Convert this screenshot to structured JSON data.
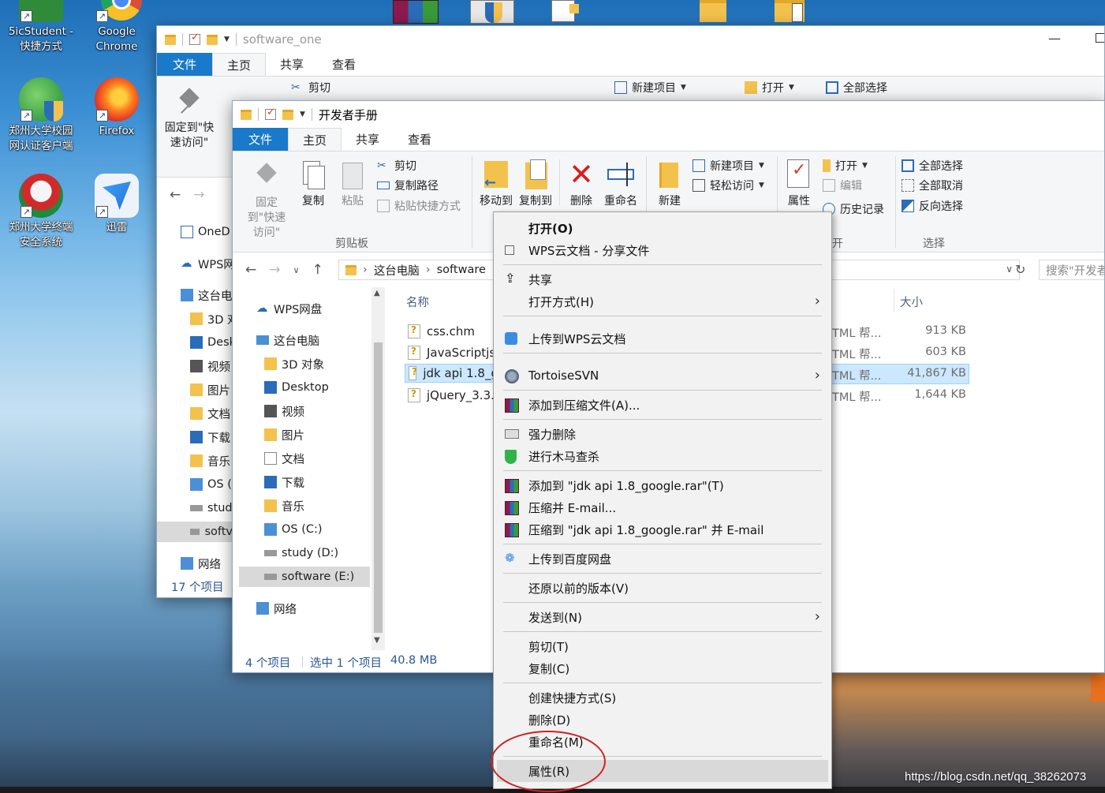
{
  "desktop": {
    "icons": [
      {
        "label1": "5icStudent -",
        "label2": "快捷方式",
        "color": "#2f8a3a"
      },
      {
        "label1": "Google",
        "label2": "Chrome",
        "color": "#dd4b39"
      },
      {
        "label1": "郑州大学校园",
        "label2": "网认证客户端",
        "color": "#1e8a3c"
      },
      {
        "label1": "Firefox",
        "label2": "",
        "color": "#ff7f1e"
      },
      {
        "label1": "郑州大学终端",
        "label2": "安全系统",
        "color": "#d12a2a"
      },
      {
        "label1": "迅雷",
        "label2": "",
        "color": "#2b6fdb"
      }
    ],
    "watermark": "https://blog.csdn.net/qq_38262073"
  },
  "back_window": {
    "title": "software_one",
    "tabs": [
      "文件",
      "主页",
      "共享",
      "查看"
    ],
    "ribbon": {
      "pin_label": "固定到\"快速访问\"",
      "cut": "剪切",
      "new_item": "新建项目",
      "open": "打开",
      "select_all": "全部选择"
    },
    "nav": [
      "OneD",
      "WPS网",
      "这台电",
      "3D 对",
      "Desk",
      "视频",
      "图片",
      "文档",
      "下载",
      "音乐",
      "OS (",
      "stud",
      "softv",
      "网络"
    ],
    "status": "17 个项目"
  },
  "front_window": {
    "title": "开发者手册",
    "tabs": [
      "文件",
      "主页",
      "共享",
      "查看"
    ],
    "ribbon": {
      "pin": "固定到\"快速访问\"",
      "copy": "复制",
      "paste": "粘贴",
      "cut": "剪切",
      "copy_path": "复制路径",
      "paste_shortcut": "粘贴快捷方式",
      "clipboard_group": "剪贴板",
      "move_to": "移动到",
      "copy_to": "复制到",
      "delete": "删除",
      "rename": "重命名",
      "new": "新建",
      "new_item": "新建项目",
      "easy_access": "轻松访问",
      "properties": "属性",
      "open": "打开",
      "edit": "编辑",
      "history": "历史记录",
      "open_group": "开",
      "select_all": "全部选择",
      "select_none": "全部取消",
      "invert": "反向选择",
      "select_group": "选择"
    },
    "address": {
      "seg1": "这台电脑",
      "seg2": "software"
    },
    "search_placeholder": "搜索\"开发者",
    "nav": [
      {
        "label": "WPS网盘",
        "icon": "cloud-icon"
      },
      {
        "label": "这台电脑",
        "icon": "pc-icon"
      },
      {
        "label": "3D 对象",
        "icon": "folder-icon"
      },
      {
        "label": "Desktop",
        "icon": "folder-icon"
      },
      {
        "label": "视频",
        "icon": "folder-icon"
      },
      {
        "label": "图片",
        "icon": "folder-icon"
      },
      {
        "label": "文档",
        "icon": "folder-icon"
      },
      {
        "label": "下载",
        "icon": "folder-icon"
      },
      {
        "label": "音乐",
        "icon": "folder-icon"
      },
      {
        "label": "OS (C:)",
        "icon": "drive-icon"
      },
      {
        "label": "study (D:)",
        "icon": "drive-icon"
      },
      {
        "label": "software (E:)",
        "icon": "drive-icon"
      },
      {
        "label": "网络",
        "icon": "network-icon"
      }
    ],
    "columns": {
      "name": "名称",
      "size": "大小"
    },
    "files": [
      {
        "name": "css.chm",
        "type": "TML 帮...",
        "size": "913 KB"
      },
      {
        "name": "JavaScriptjs",
        "type": "TML 帮...",
        "size": "603 KB"
      },
      {
        "name": "jdk api 1.8_g",
        "type": "TML 帮...",
        "size": "41,867 KB"
      },
      {
        "name": "jQuery_3.3.1",
        "type": "TML 帮...",
        "size": "1,644 KB"
      }
    ],
    "status": {
      "count": "4 个项目",
      "selected": "选中 1 个项目",
      "size": "40.8 MB"
    }
  },
  "context_menu": {
    "items": [
      "打开(O)",
      "WPS云文档 - 分享文件",
      "共享",
      "打开方式(H)",
      "上传到WPS云文档",
      "TortoiseSVN",
      "添加到压缩文件(A)...",
      "强力删除",
      "进行木马查杀",
      "添加到 \"jdk api 1.8_google.rar\"(T)",
      "压缩并 E-mail...",
      "压缩到 \"jdk api 1.8_google.rar\" 并 E-mail",
      "上传到百度网盘",
      "还原以前的版本(V)",
      "发送到(N)",
      "剪切(T)",
      "复制(C)",
      "创建快捷方式(S)",
      "删除(D)",
      "重命名(M)",
      "属性(R)"
    ]
  }
}
